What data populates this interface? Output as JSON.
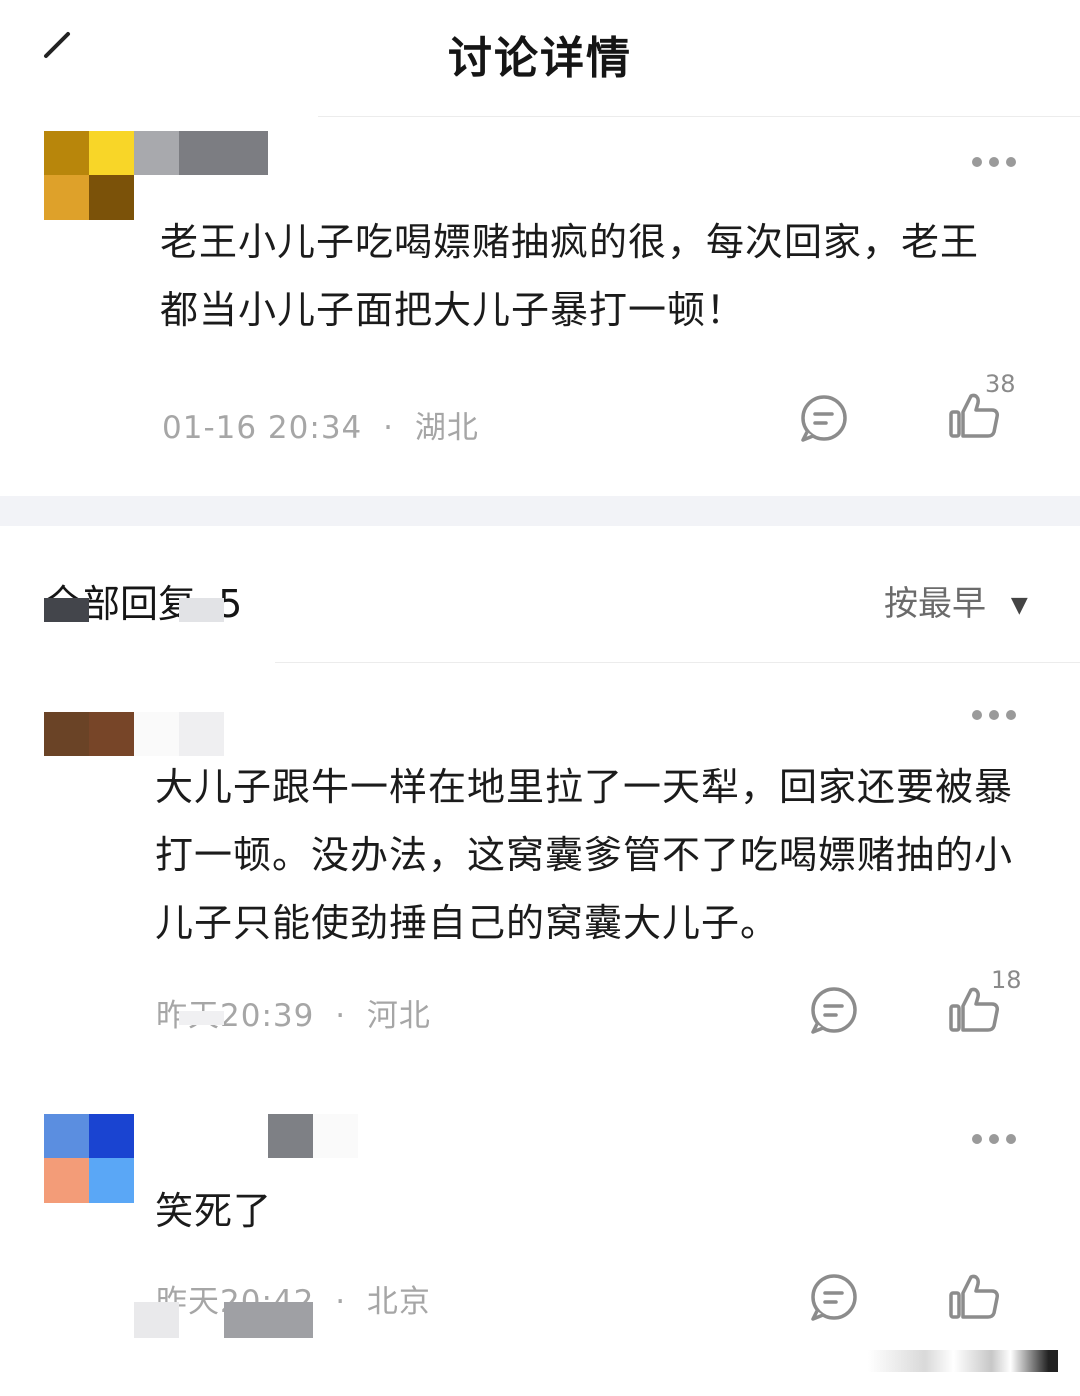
{
  "header": {
    "title": "讨论详情",
    "edit_icon": "pencil-icon"
  },
  "main_post": {
    "text": "老王小儿子吃喝嫖赌抽疯的很，每次回家，老王都当小儿子面把大儿子暴打一顿！",
    "time": "01-16 20:34",
    "separator": "·",
    "location": "湖北",
    "likes": "38"
  },
  "replies_header": {
    "label": "全部回复",
    "count": "5",
    "sort_label": "按最早"
  },
  "replies": [
    {
      "text": "大儿子跟牛一样在地里拉了一天犁，回家还要被暴打一顿。没办法，这窝囊爹管不了吃喝嫖赌抽的小儿子只能使劲捶自己的窝囊大儿子。",
      "time": "昨天20:39",
      "separator": "·",
      "location": "河北",
      "likes": "18"
    },
    {
      "text": "笑死了",
      "time": "昨天20:42",
      "separator": "·",
      "location": "北京",
      "likes": ""
    }
  ],
  "colors": {
    "text": "#1b1b1b",
    "meta": "#a6a6a6",
    "icon": "#8c8c8c",
    "divider_band": "#f2f3f7"
  }
}
